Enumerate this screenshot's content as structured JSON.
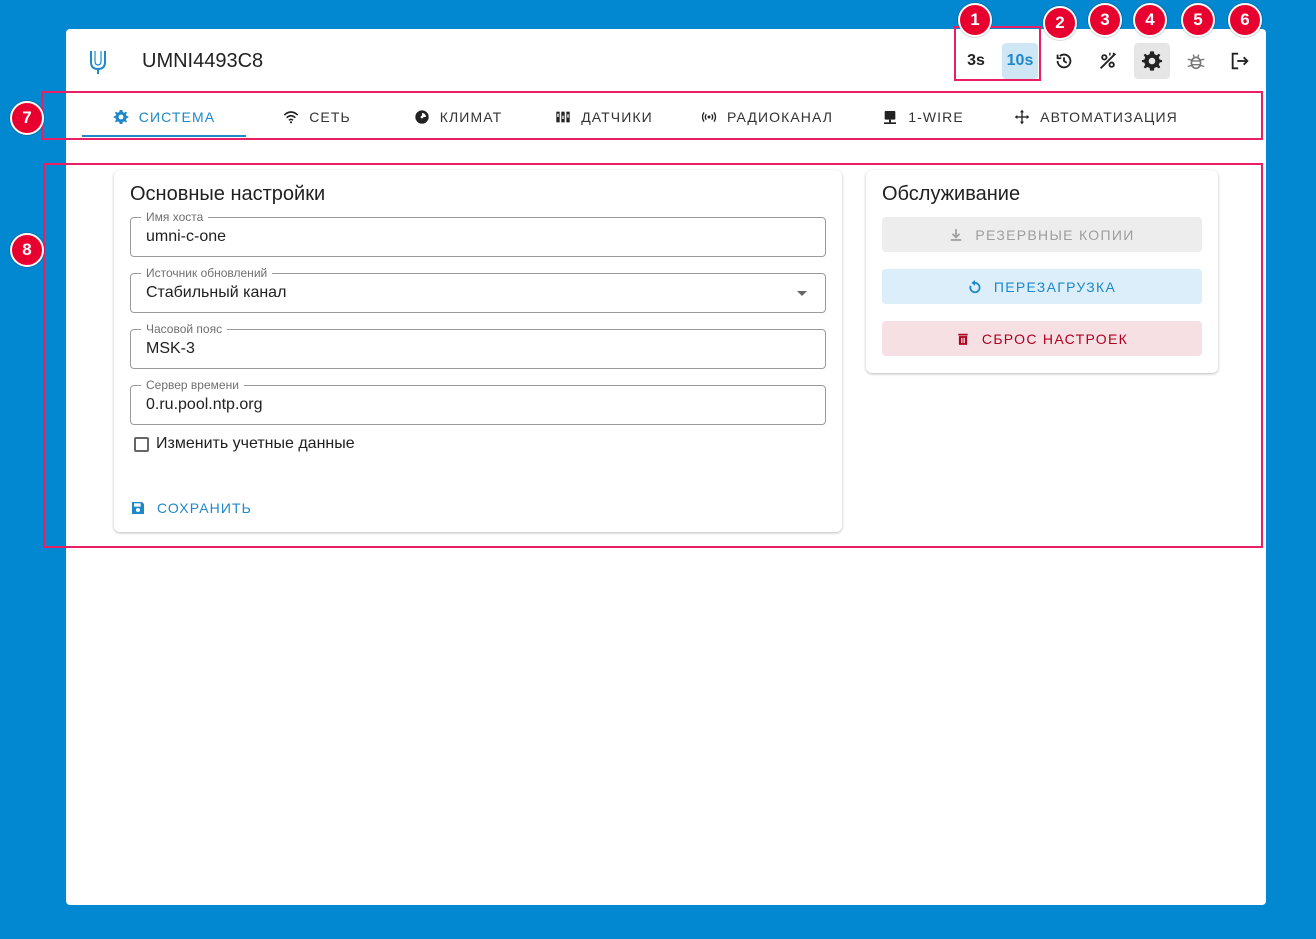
{
  "header": {
    "title": "UMNI4493C8",
    "rates": [
      "3s",
      "10s"
    ],
    "icons": [
      "history-icon",
      "accent-off-icon",
      "settings-icon",
      "debug-icon",
      "logout-icon"
    ]
  },
  "tabs": [
    {
      "label": "Система",
      "icon": "gear-icon"
    },
    {
      "label": "Сеть",
      "icon": "wifi-icon"
    },
    {
      "label": "Климат",
      "icon": "climate-icon"
    },
    {
      "label": "Датчики",
      "icon": "sensors-icon"
    },
    {
      "label": "Радиоканал",
      "icon": "radio-icon"
    },
    {
      "label": "1-Wire",
      "icon": "onewire-icon"
    },
    {
      "label": "Автоматизация",
      "icon": "automation-icon"
    }
  ],
  "main": {
    "title": "Основные настройки",
    "fields": [
      {
        "label": "Имя хоста",
        "value": "umni-c-one"
      },
      {
        "label": "Источник обновлений",
        "value": "Стабильный канал"
      },
      {
        "label": "Часовой пояс",
        "value": "MSK-3"
      },
      {
        "label": "Сервер времени",
        "value": "0.ru.pool.ntp.org"
      }
    ],
    "checkbox_label": "Изменить учетные данные",
    "save_label": "СОХРАНИТЬ"
  },
  "maintenance": {
    "title": "Обслуживание",
    "backup_label": "Резервные копии",
    "reboot_label": "Перезагрузка",
    "reset_label": "Сброс настроек"
  },
  "annotations": [
    "1",
    "2",
    "3",
    "4",
    "5",
    "6",
    "7",
    "8"
  ],
  "colors": {
    "background": "#0288d1",
    "accent": "#1e88c8",
    "danger": "#b00020",
    "annotation": "#e8002e"
  }
}
